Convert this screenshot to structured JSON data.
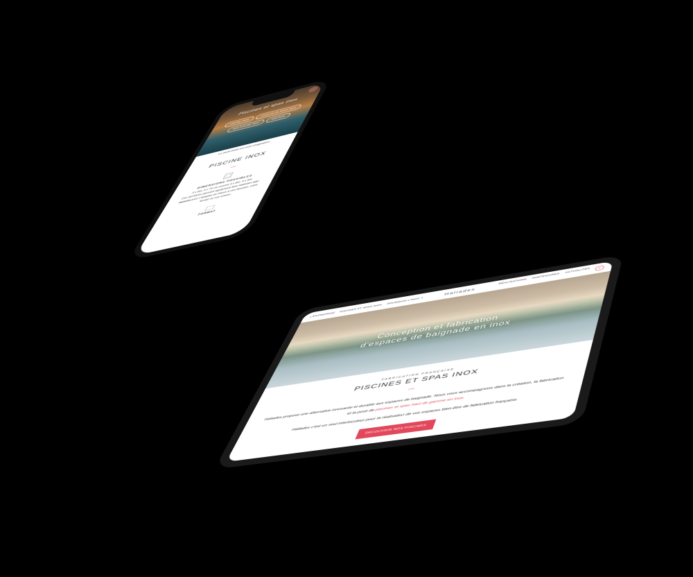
{
  "accent": "#e2475b",
  "tablet": {
    "nav_left": [
      "L'ENTREPRISE",
      "PISCINES ET SPAS INOX",
      "POURQUOI L'INOX ?"
    ],
    "logo": "Haliades",
    "nav_right": [
      "RÉALISATIONS",
      "PARTENAIRES",
      "ACTUALITÉS"
    ],
    "hero_line1": "Conception et fabrication",
    "hero_line2": "d'espaces de baignade en inox",
    "eyebrow": "FABRICATION FRANÇAISE",
    "title": "PISCINES ET SPAS INOX",
    "para_1a": "Haliades propose une alternative innovante et durable aux espaces de baignade. Nous vous accompagnons dans la création, la fabrication et la pose de ",
    "para_1_hl": "piscines et spas haut de gamme en inox.",
    "para_2": "Haliades c'est un seul interlocuteur pour la réalisation de vos espaces bien-être de fabrication française.",
    "cta": "DÉCOUVRIR NOS PISCINES"
  },
  "phone": {
    "hero_title": "Piscines et spas inox",
    "chips": [
      "PISCINE INOX",
      "COULOIR DE NAGE INOX",
      "MINI PISCINE INOX",
      "SPA INOX"
    ],
    "tagline": "La seule limite est votre imagination.",
    "title": "PISCINE INOX",
    "section1_heading": "DIMENSIONS POSSIBLES",
    "section1_body_a": "3 x 6m, 3 x 7m ou encore 4 x 8m, 4 x 9m.",
    "section1_body_b": "Ces dernières peuvent également être réalisées ",
    "section1_body_bold": "sur-mesure",
    "section1_body_c": " pour s'adapter au mieux à vos besoins, votre terrain ou vos envies.",
    "section2_heading": "FORMAT"
  }
}
